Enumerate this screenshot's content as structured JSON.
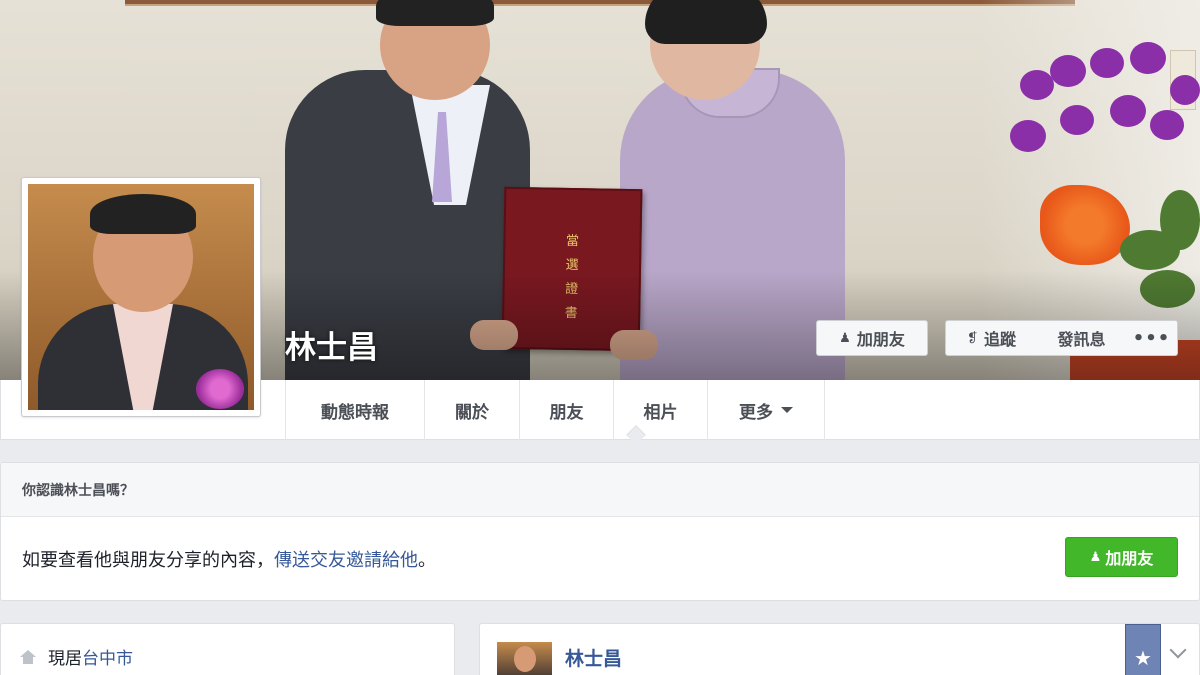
{
  "profile": {
    "name": "林士昌"
  },
  "cover": {
    "certificate_text": "當選證書",
    "buttons": {
      "add_friend": "加朋友",
      "follow": "追蹤",
      "message": "發訊息",
      "more": "•••"
    },
    "icons": {
      "add_friend": "add-person-icon",
      "follow": "rss-icon"
    }
  },
  "nav": {
    "tabs": [
      {
        "label": "動態時報"
      },
      {
        "label": "關於"
      },
      {
        "label": "朋友"
      },
      {
        "label": "相片"
      },
      {
        "label": "更多"
      }
    ]
  },
  "know_panel": {
    "title": "你認識林士昌嗎？",
    "text_prefix": "如要查看他與朋友分享的內容，",
    "link_text": "傳送交友邀請給他",
    "text_suffix": "。",
    "button_label": "加朋友"
  },
  "intro": {
    "label": "現居",
    "city": "台中市",
    "icon": "house-icon"
  },
  "post": {
    "author": "林士昌",
    "star": "★"
  },
  "colors": {
    "link": "#365899",
    "green_button": "#42b72a",
    "page_bg": "#e9ebee"
  }
}
